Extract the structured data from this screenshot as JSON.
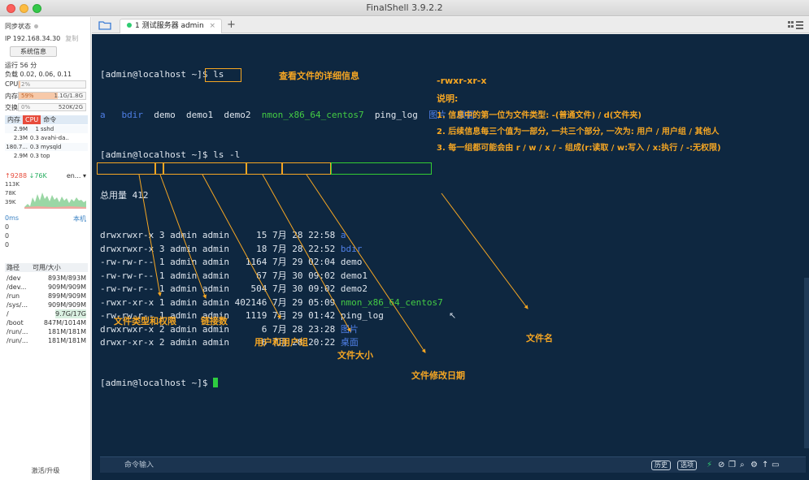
{
  "window": {
    "title": "FinalShell 3.9.2.2"
  },
  "sidebar": {
    "sync_label": "同步状态",
    "ip": "IP 192.168.34.30",
    "copy_label": "复制",
    "sysinfo_button": "系统信息",
    "uptime": "运行 56 分",
    "load": "负载 0.02, 0.06, 0.11",
    "cpu": {
      "label": "CPU",
      "value": "2%",
      "fraction": 0.02
    },
    "memory": {
      "label": "内存",
      "percent": "59%",
      "value": "1.1G/1.8G",
      "fraction": 0.59
    },
    "swap": {
      "label": "交换",
      "percent": "0%",
      "value": "520K/2G",
      "fraction": 0.0
    },
    "process_headers": {
      "memory": "内存",
      "cpu": "CPU",
      "command": "命令"
    },
    "processes": [
      {
        "mem": "2.9M",
        "cpu": "1",
        "cmd": "sshd"
      },
      {
        "mem": "2.3M",
        "cpu": "0.3",
        "cmd": "avahi-da.."
      },
      {
        "mem": "180.7...",
        "cpu": "0.3",
        "cmd": "mysqld"
      },
      {
        "mem": "2.9M",
        "cpu": "0.3",
        "cmd": "top"
      }
    ],
    "network": {
      "up": "↑9288",
      "down": "↓76K",
      "iface": "en...",
      "scale": [
        "113K",
        "78K",
        "39K"
      ]
    },
    "ping": {
      "latency": "0ms",
      "host": "本机",
      "values": [
        "0",
        "0",
        "0"
      ]
    },
    "disk_headers": {
      "path": "路径",
      "size": "可用/大小"
    },
    "disks": [
      {
        "path": "/dev",
        "size": "893M/893M"
      },
      {
        "path": "/dev...",
        "size": "909M/909M"
      },
      {
        "path": "/run",
        "size": "899M/909M"
      },
      {
        "path": "/sys/...",
        "size": "909M/909M"
      },
      {
        "path": "/",
        "size": "9.7G/17G"
      },
      {
        "path": "/boot",
        "size": "847M/1014M"
      },
      {
        "path": "/run/...",
        "size": "181M/181M"
      },
      {
        "path": "/run/...",
        "size": "181M/181M"
      }
    ],
    "upgrade_label": "激活/升级"
  },
  "tabs": [
    {
      "label": "1 测试服务器 admin",
      "close": "×"
    }
  ],
  "add_tab": "+",
  "terminal": {
    "line1": "[admin@localhost ~]$ ls",
    "ls_items": [
      "a",
      "bdir",
      "demo",
      "demo1",
      "demo2",
      "nmon_x86_64_centos7",
      "ping_log",
      "图片",
      "桌面"
    ],
    "prompt2": "[admin@localhost ~]$ ",
    "cmd2": "ls -l",
    "total": "总用量 412",
    "rows": [
      {
        "perm": "drwxrwxr-x",
        "links": "3",
        "user": "admin",
        "group": "admin",
        "size": "15",
        "month": "7月",
        "day": "28",
        "time": "22:58",
        "name": "a"
      },
      {
        "perm": "drwxrwxr-x",
        "links": "3",
        "user": "admin",
        "group": "admin",
        "size": "18",
        "month": "7月",
        "day": "28",
        "time": "22:52",
        "name": "bdir"
      },
      {
        "perm": "-rw-rw-r--",
        "links": "1",
        "user": "admin",
        "group": "admin",
        "size": "1164",
        "month": "7月",
        "day": "29",
        "time": "02:04",
        "name": "demo"
      },
      {
        "perm": "-rw-rw-r--",
        "links": "1",
        "user": "admin",
        "group": "admin",
        "size": "67",
        "month": "7月",
        "day": "30",
        "time": "09:02",
        "name": "demo1"
      },
      {
        "perm": "-rw-rw-r--",
        "links": "1",
        "user": "admin",
        "group": "admin",
        "size": "504",
        "month": "7月",
        "day": "30",
        "time": "09:02",
        "name": "demo2"
      },
      {
        "perm": "-rwxr-xr-x",
        "links": "1",
        "user": "admin",
        "group": "admin",
        "size": "402146",
        "month": "7月",
        "day": "29",
        "time": "05:09",
        "name": "nmon_x86_64_centos7"
      },
      {
        "perm": "-rw-rw-r--",
        "links": "1",
        "user": "admin",
        "group": "admin",
        "size": "1119",
        "month": "7月",
        "day": "29",
        "time": "01:42",
        "name": "ping_log"
      },
      {
        "perm": "drwxrwxr-x",
        "links": "2",
        "user": "admin",
        "group": "admin",
        "size": "6",
        "month": "7月",
        "day": "28",
        "time": "23:28",
        "name": "图片"
      },
      {
        "perm": "drwxr-xr-x",
        "links": "2",
        "user": "admin",
        "group": "admin",
        "size": "6",
        "month": "7月",
        "day": "28",
        "time": "20:22",
        "name": "桌面"
      }
    ],
    "prompt_last": "[admin@localhost ~]$ "
  },
  "annotations": {
    "detail_info": "查看文件的详细信息",
    "perm_example": "-rwxr-xr-x",
    "explain_title": "说明:",
    "explain_1": "1. 信息中的第一位为文件类型: -(普通文件) / d(文件夹)",
    "explain_2": "2. 后续信息每三个值为一部分, 一共三个部分, 一次为: 用户 / 用户组 / 其他人",
    "explain_3": "3. 每一组都可能会由 r / w / x / - 组成(r:读取 / w:写入 / x:执行 / -:无权限)",
    "type_perm": "文件类型和权限",
    "link_count": "链接数",
    "user_group": "用户和用户组",
    "file_size": "文件大小",
    "mod_date": "文件修改日期",
    "file_name": "文件名"
  },
  "command_bar": {
    "placeholder": "命令输入",
    "history": "历史",
    "options": "选项"
  },
  "colors": {
    "terminal_bg": "#0e2740",
    "annotation": "#f5a623",
    "dir_blue": "#4f7fe6",
    "exec_green": "#44cc44"
  }
}
